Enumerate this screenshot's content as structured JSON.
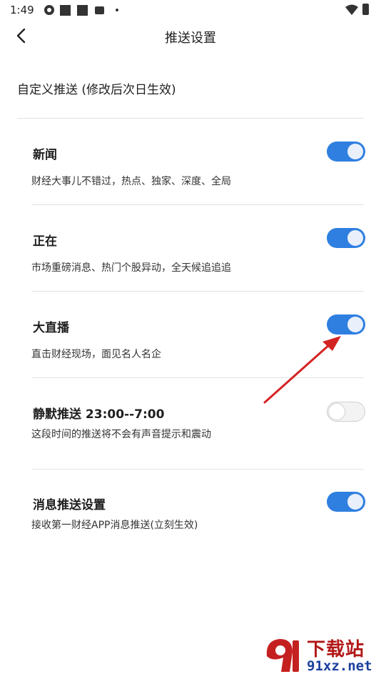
{
  "status_bar": {
    "time": "1:49"
  },
  "header": {
    "title": "推送设置"
  },
  "section": {
    "title": "自定义推送 (修改后次日生效)"
  },
  "settings": [
    {
      "title": "新闻",
      "desc": "财经大事儿不错过，热点、独家、深度、全局",
      "enabled": true
    },
    {
      "title": "正在",
      "desc": "市场重磅消息、热门个股异动，全天候追追追",
      "enabled": true
    },
    {
      "title": "大直播",
      "desc": "直击财经现场，面见名人名企",
      "enabled": true
    },
    {
      "title": "静默推送 23:00--7:00",
      "desc": "这段时间的推送将不会有声音提示和震动",
      "enabled": false
    },
    {
      "title": "消息推送设置",
      "desc": "接收第一财经APP消息推送(立刻生效)",
      "enabled": true
    }
  ],
  "colors": {
    "toggle_on": "#2f7fe0",
    "annotation_arrow": "#d42323"
  },
  "watermark": {
    "top": "下载站",
    "bottom": "91xz.net"
  }
}
